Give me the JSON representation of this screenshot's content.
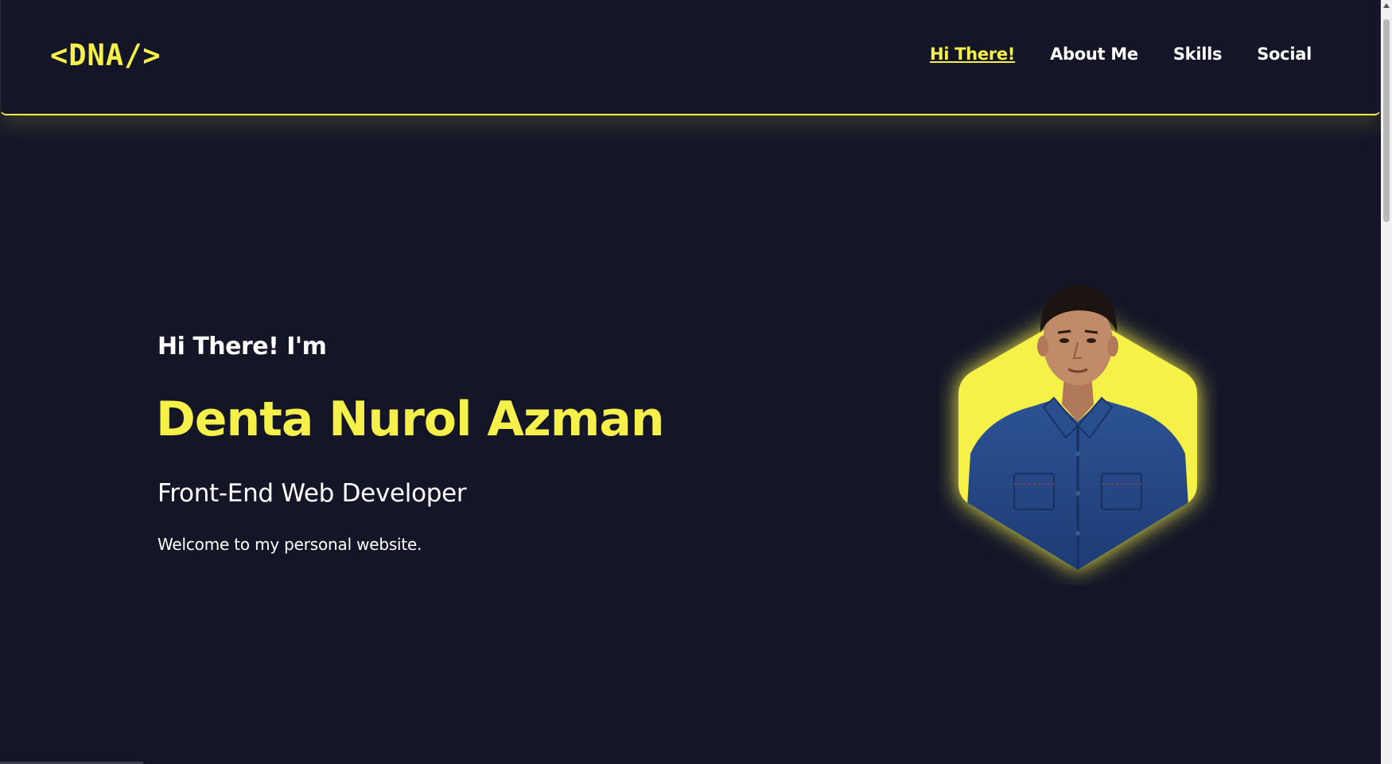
{
  "header": {
    "logo": "<DNA/>",
    "nav": [
      {
        "label": "Hi There!",
        "active": true
      },
      {
        "label": "About Me",
        "active": false
      },
      {
        "label": "Skills",
        "active": false
      },
      {
        "label": "Social",
        "active": false
      }
    ]
  },
  "hero": {
    "greeting": "Hi There! I'm",
    "name": "Denta Nurol Azman",
    "role": "Front-End Web Developer",
    "welcome": "Welcome to my personal website."
  },
  "colors": {
    "background": "#141628",
    "accent": "#f6f14a",
    "text": "#ffffff"
  },
  "portrait": {
    "shape": "hexagon",
    "subject": "person-in-denim-shirt-icon"
  }
}
